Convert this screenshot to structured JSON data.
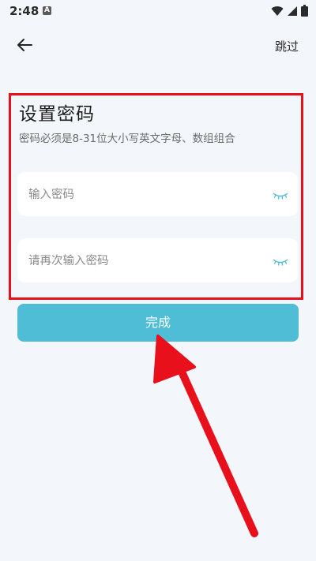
{
  "status_bar": {
    "time": "2:48",
    "notification_badge": "A",
    "icons": [
      "wifi-icon",
      "signal-icon",
      "battery-icon"
    ]
  },
  "header": {
    "back_icon": "arrow-left-icon",
    "skip_label": "跳过"
  },
  "form": {
    "title": "设置密码",
    "subtitle": "密码必须是8-31位大小写英文字母、数组组合",
    "password": {
      "value": "",
      "placeholder": "输入密码",
      "toggle_icon": "eye-closed-icon"
    },
    "confirm_password": {
      "value": "",
      "placeholder": "请再次输入密码",
      "toggle_icon": "eye-closed-icon"
    }
  },
  "actions": {
    "done_label": "完成"
  },
  "colors": {
    "background": "#f3f6fa",
    "accent_button": "#4fbdd6",
    "eye_icon": "#4fbdd6",
    "annotation_red": "#e8101b"
  }
}
